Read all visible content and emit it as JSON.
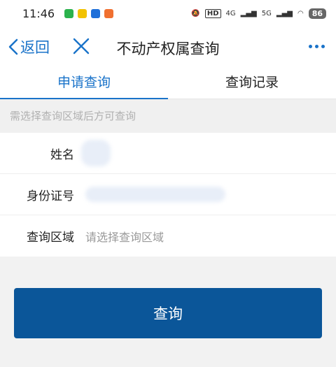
{
  "status_bar": {
    "time": "11:46",
    "network_4g": "4G",
    "network_5g": "5G",
    "battery": "86",
    "hd_badge": "HD"
  },
  "nav": {
    "back_label": "返回",
    "title": "不动产权属查询"
  },
  "tabs": [
    {
      "label": "申请查询",
      "active": true
    },
    {
      "label": "查询记录",
      "active": false
    }
  ],
  "hint": "需选择查询区域后方可查询",
  "form": {
    "name_label": "姓名",
    "id_label": "身份证号",
    "region_label": "查询区域",
    "region_placeholder": "请选择查询区域"
  },
  "submit_label": "查询",
  "colors": {
    "accent": "#1a73c9",
    "button": "#0b5699"
  }
}
